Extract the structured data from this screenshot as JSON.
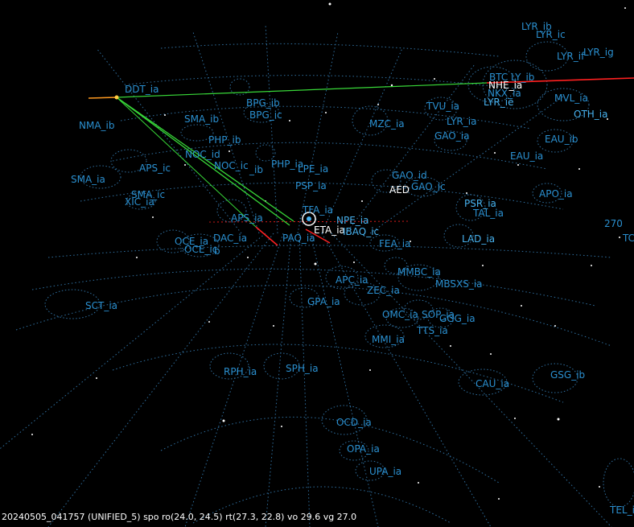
{
  "status_line": "20240505_041757 (UNIFIED_5) spo ro(24.0, 24.5) rt(27.3, 22.8) vo 29.6 vg 27.0",
  "colors": {
    "background": "#000000",
    "label": "#2a8fcf",
    "label_bright": "#47b2ef",
    "grid": "#2f6f9f",
    "track_green": "#38d838",
    "track_red": "#ff2020",
    "track_orange": "#ff9a20"
  },
  "labels": {
    "lyr_ib": "LYR_ib",
    "lyr_ic": "LYR_ic",
    "lyr_if": "LYR_if",
    "lyr_ig": "LYR_ig",
    "btc_ib": "BTC LY_ib",
    "nhe_ia": "NHE_ia",
    "nkx_ia": "NKX_ia",
    "lyr_ie": "LYR_ie",
    "mvl_ia": "MVL_ia",
    "oth_ia": "OTH_ia",
    "ddt_ia": "DDT_ia",
    "bpg_ib": "BPG_ib",
    "bpg_ic": "BPG_ic",
    "tvu_ia": "TVU_ia",
    "nma_ib": "NMA_ib",
    "sma_ib": "SMA_ib",
    "mzc_ia": "MZC_ia",
    "lyr_ia": "LYR_ia",
    "gao_ia": "GAO_ia",
    "eau_ib": "EAU_ib",
    "php_ib": "PHP_ib",
    "noc_id": "NOC_id",
    "eau_ia": "EAU_ia",
    "aps_ic": "APS_ic",
    "noc_ic": "NOC_ic",
    "id_ib": "_ib",
    "php_ia": "PHP_ia",
    "lpe_ia": "LPE_ia",
    "gao_id": "GAO_id",
    "sma_ia": "SMA_ia",
    "psp_ia": "PSP_ia",
    "aed": "AED",
    "gao_ic": "GAO_ic",
    "sma_ic": "SMA_ic",
    "xic_ia": "XIC_ia",
    "apo_ia": "APO_ia",
    "psr_ia": "PSR_ia",
    "tfa_ia": "TFA_ia",
    "tal_ia": "TAL_ia",
    "aps_ia": "APS_ia",
    "npe_ia": "NPE_ia",
    "n270": "270",
    "eta_ia": "ETA_ia",
    "baq_ic": "IBAQ_ic",
    "tc": "TC",
    "dac_ia": "DAC_ia",
    "paq_ia": "PAQ_ia",
    "lad_ia": "LAD_ia",
    "oce_ia": "OCE_ia",
    "oce_ic": "OCE_ic",
    "b": "b",
    "fea_ia": "FEA_ia",
    "mmbc_ia": "MMBC_ia",
    "apc_ia": "APC_ia",
    "mbsxs_ia": "MBSXS_ia",
    "zec_ia": "ZEC_ia",
    "gpa_ia": "GPA_ia",
    "sct_ia": "SCT_ia",
    "omc_ia": "OMC_ia",
    "sop_ia": "SOP_ia",
    "ggg_ia": "GGG_ia",
    "tts_ia": "TTS_ia",
    "mmi_ia": "MMI_ia",
    "rph_ia": "RPH_ia",
    "sph_ia": "SPH_ia",
    "gsg_ib": "GSG_ib",
    "cau_ia": "CAU_ia",
    "ocd_ia": "OCD_ia",
    "opa_ia": "OPA_ia",
    "upa_ia": "UPA_ia",
    "tel_ia": "TEL_ia"
  }
}
